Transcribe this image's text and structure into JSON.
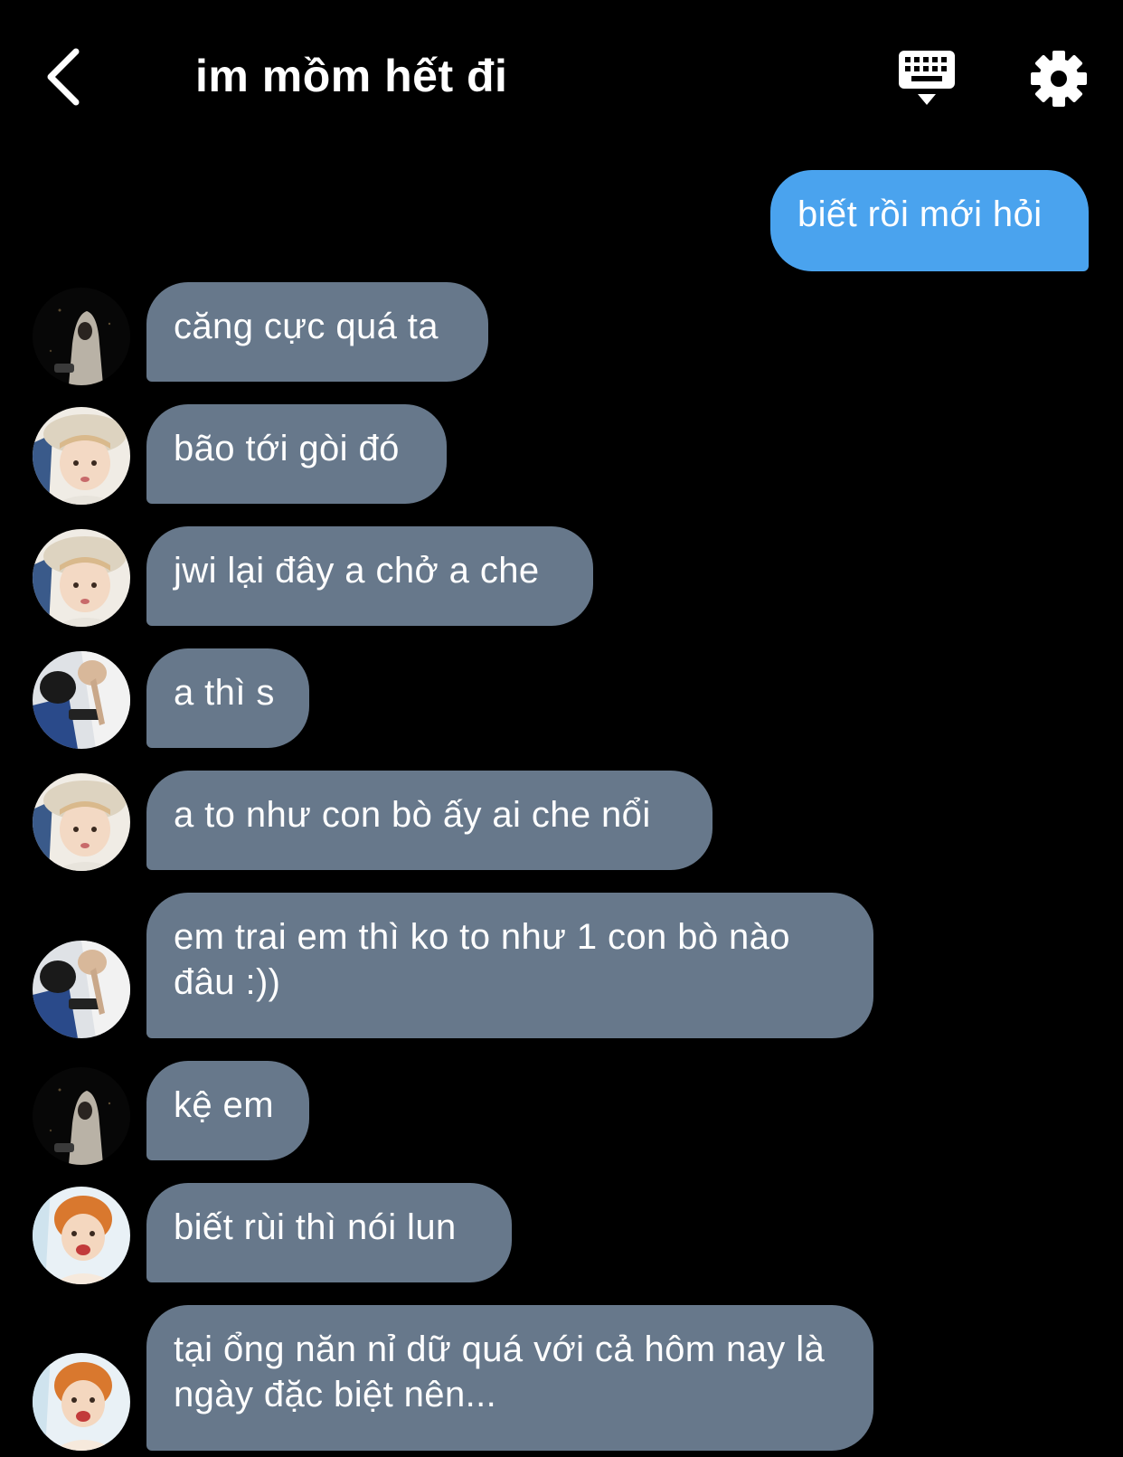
{
  "header": {
    "title": "im mồm hết đi",
    "back_icon": "chevron-left-icon",
    "keyboard_icon": "keyboard-icon",
    "settings_icon": "gear-icon"
  },
  "colors": {
    "background": "#000000",
    "incoming_bubble": "#67788b",
    "outgoing_bubble": "#4aa3ee",
    "text": "#ffffff"
  },
  "messages": [
    {
      "sender": "me",
      "text": "biết rồi mới hỏi"
    },
    {
      "sender": "hooded-dark",
      "text": "căng cực quá ta"
    },
    {
      "sender": "bucket-hat",
      "text": "bão tới gòi đó"
    },
    {
      "sender": "bucket-hat",
      "text": "jwi lại đây a chở a che"
    },
    {
      "sender": "blue-shirt",
      "text": "a thì s"
    },
    {
      "sender": "bucket-hat",
      "text": "a to như con bò ấy ai che nổi"
    },
    {
      "sender": "blue-shirt",
      "text": "em trai em thì ko to như 1 con bò nào đâu :))"
    },
    {
      "sender": "hooded-dark",
      "text": "kệ em"
    },
    {
      "sender": "orange-hair",
      "text": "biết rùi thì nói lun"
    },
    {
      "sender": "orange-hair",
      "text": "tại ổng năn nỉ dữ quá với cả hôm nay là ngày đặc biệt nên..."
    }
  ]
}
